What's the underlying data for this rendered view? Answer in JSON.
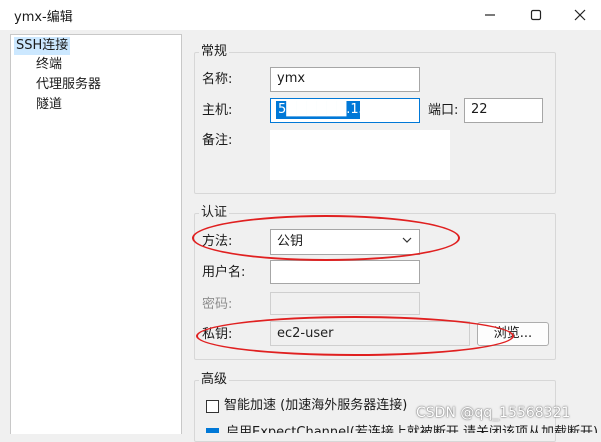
{
  "window": {
    "title": "ymx-编辑",
    "minimize_icon": "minimize-icon",
    "maximize_icon": "maximize-icon",
    "close_icon": "close-icon"
  },
  "tree": {
    "items": [
      {
        "label": "SSH连接",
        "selected": true
      },
      {
        "label": "终端",
        "selected": false
      },
      {
        "label": "代理服务器",
        "selected": false
      },
      {
        "label": "隧道",
        "selected": false
      }
    ]
  },
  "general": {
    "title": "常规",
    "name_label": "名称:",
    "name_value": "ymx",
    "host_label": "主机:",
    "host_value": "5██████.15.7",
    "port_label": "端口:",
    "port_value": "22",
    "note_label": "备注:",
    "note_value": ""
  },
  "auth": {
    "title": "认证",
    "method_label": "方法:",
    "method_value": "公钥",
    "username_label": "用户名:",
    "username_value": "",
    "password_label": "密码:",
    "password_value": "",
    "key_label": "私钥:",
    "key_value": "ec2-user",
    "browse_label": "浏览..."
  },
  "advanced": {
    "title": "高级",
    "accelerate_label": "智能加速 (加速海外服务器连接)",
    "accelerate_checked": false,
    "second_option_label": "启用ExpectChannel(若连接上就被断开,请关闭该项从加载断开)",
    "second_option_checked": true
  },
  "watermark": "CSDN @qq_15568321",
  "colors": {
    "accent": "#0078d7",
    "annotation_red": "#e02020",
    "selection": "#cce8ff"
  }
}
